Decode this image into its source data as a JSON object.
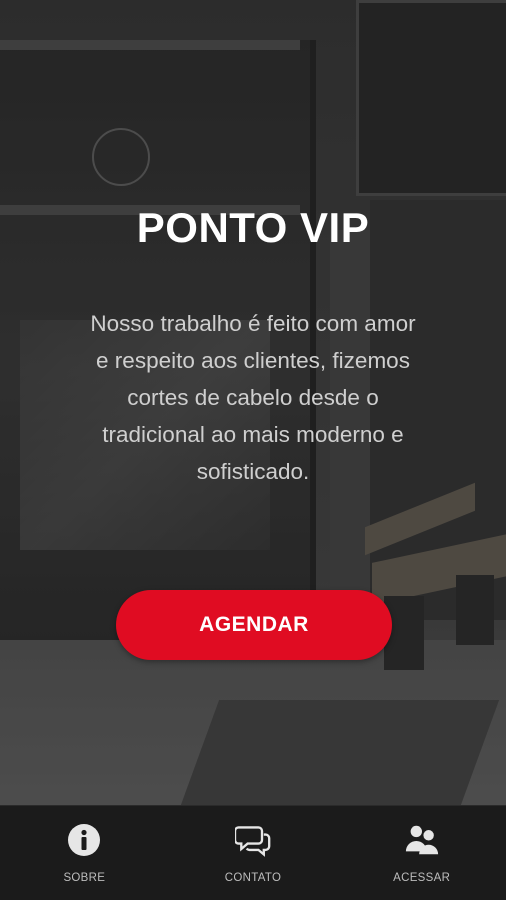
{
  "hero": {
    "title": "PONTO VIP",
    "description": "Nosso trabalho é feito com amor e respeito aos clientes, fizemos cortes de cabelo desde o tradicional ao mais moderno e sofisticado.",
    "cta_label": "AGENDAR"
  },
  "nav": {
    "items": [
      {
        "label": "SOBRE",
        "icon": "info-icon"
      },
      {
        "label": "CONTATO",
        "icon": "chat-bubbles-icon"
      },
      {
        "label": "ACESSAR",
        "icon": "users-icon"
      }
    ]
  },
  "colors": {
    "accent": "#e00c22",
    "nav_background": "#1b1b1b",
    "text_light": "#ffffff",
    "text_muted": "#cfcfcf"
  }
}
